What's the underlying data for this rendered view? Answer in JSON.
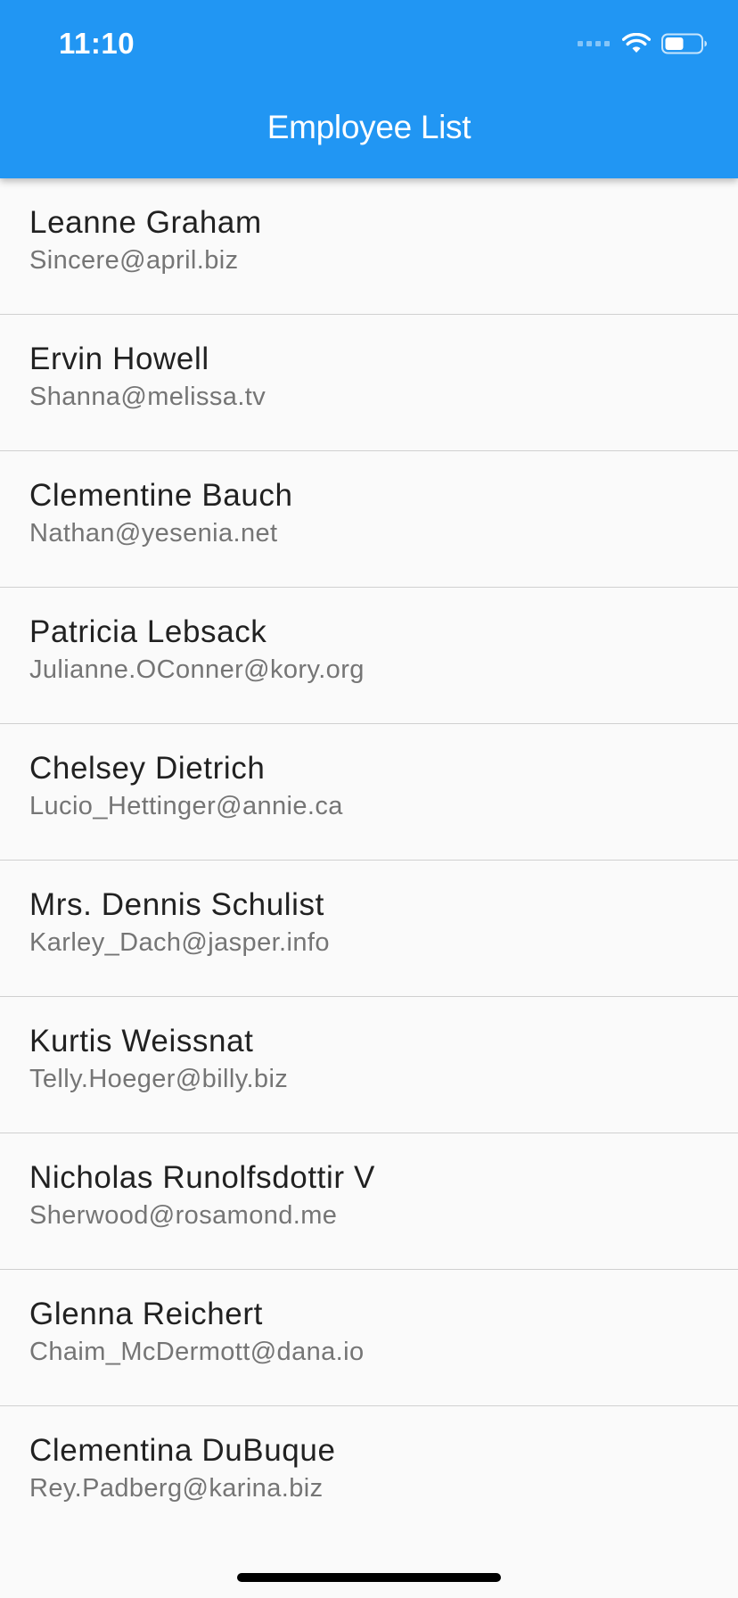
{
  "status_bar": {
    "time": "11:10",
    "icons": [
      "cellular-signal-icon",
      "wifi-icon",
      "battery-icon"
    ]
  },
  "app_bar": {
    "title": "Employee List",
    "color": "#2196f3"
  },
  "employees": [
    {
      "name": "Leanne Graham",
      "email": "Sincere@april.biz"
    },
    {
      "name": "Ervin Howell",
      "email": "Shanna@melissa.tv"
    },
    {
      "name": "Clementine Bauch",
      "email": "Nathan@yesenia.net"
    },
    {
      "name": "Patricia Lebsack",
      "email": "Julianne.OConner@kory.org"
    },
    {
      "name": "Chelsey Dietrich",
      "email": "Lucio_Hettinger@annie.ca"
    },
    {
      "name": "Mrs. Dennis Schulist",
      "email": "Karley_Dach@jasper.info"
    },
    {
      "name": "Kurtis Weissnat",
      "email": "Telly.Hoeger@billy.biz"
    },
    {
      "name": "Nicholas Runolfsdottir V",
      "email": "Sherwood@rosamond.me"
    },
    {
      "name": "Glenna Reichert",
      "email": "Chaim_McDermott@dana.io"
    },
    {
      "name": "Clementina DuBuque",
      "email": "Rey.Padberg@karina.biz"
    }
  ]
}
